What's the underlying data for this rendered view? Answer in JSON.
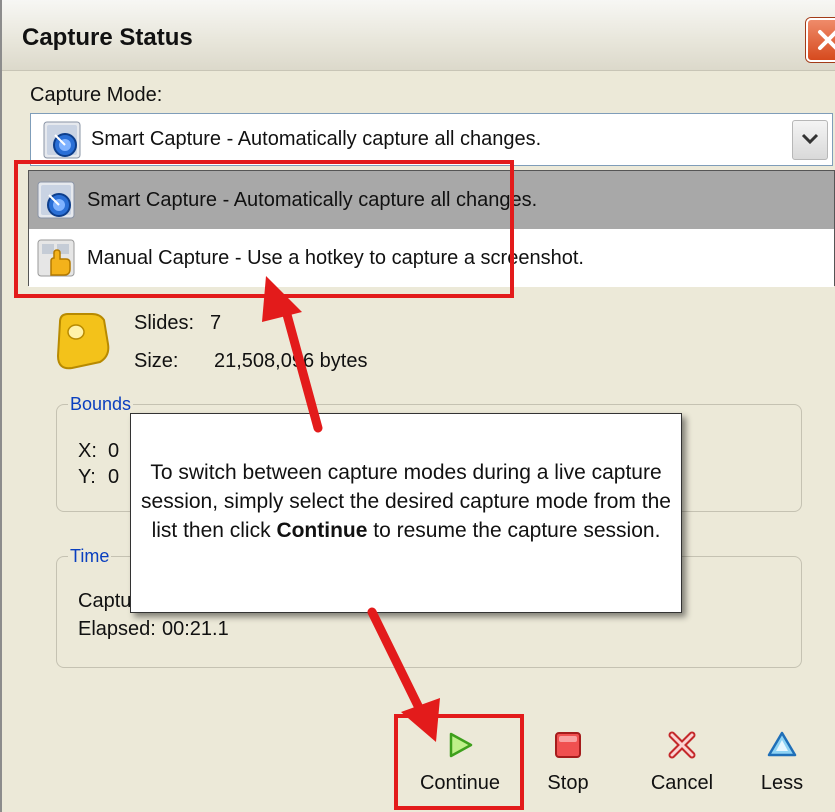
{
  "window": {
    "title": "Capture Status"
  },
  "capture_mode": {
    "label": "Capture Mode:",
    "selected": "Smart Capture - Automatically capture all changes.",
    "options": [
      {
        "label": "Smart Capture - Automatically capture all changes.",
        "icon": "smart-capture-icon"
      },
      {
        "label": "Manual Capture - Use a hotkey to capture a screenshot.",
        "icon": "manual-capture-hand-icon"
      }
    ]
  },
  "stats": {
    "slides_label": "Slides:",
    "slides_value": "7",
    "size_label": "Size:",
    "size_value": "21,508,096 bytes"
  },
  "bounds": {
    "title": "Bounds",
    "x_label": "X:",
    "x_value": "0",
    "y_label": "Y:",
    "y_value": "0"
  },
  "time": {
    "title": "Time",
    "captured_partial": "Captu",
    "elapsed_label": "Elapsed:",
    "elapsed_value": "00:21.1"
  },
  "callout": {
    "text_before": "To switch between capture modes during a live capture session, simply select the desired capture mode from the list then click ",
    "bold": "Continue",
    "text_after": " to resume the capture session."
  },
  "toolbar": {
    "continue_label": "Continue",
    "stop_label": "Stop",
    "cancel_label": "Cancel",
    "less_label": "Less"
  },
  "colors": {
    "annotation_red": "#e31b1b",
    "dialog_bg": "#ece9d8",
    "selected_row": "#a8a8a8",
    "group_title": "#0a3fbf"
  }
}
